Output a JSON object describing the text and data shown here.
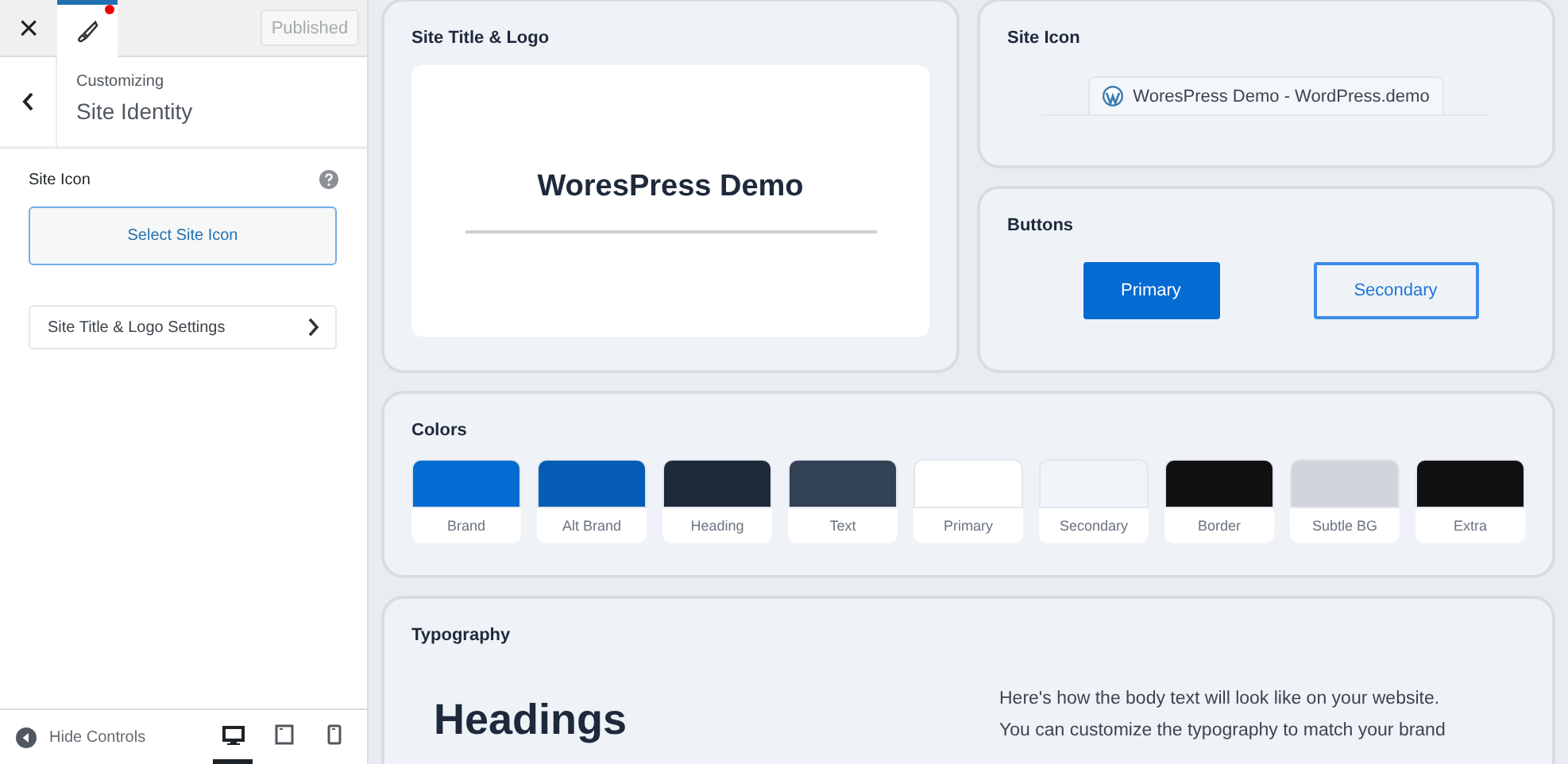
{
  "sidebar": {
    "close": "×",
    "publish_button": {
      "label": "Published",
      "disabled": true
    },
    "notification": true,
    "header": {
      "eyebrow": "Customizing",
      "title": "Site Identity"
    },
    "site_icon": {
      "label": "Site Icon",
      "button": "Select Site Icon"
    },
    "nav_item": {
      "label": "Site Title & Logo Settings"
    },
    "footer": {
      "label": "Hide Controls",
      "devices": [
        {
          "kind": "desktop",
          "selected": true
        },
        {
          "kind": "tablet",
          "selected": false
        },
        {
          "kind": "mobile",
          "selected": false
        }
      ]
    }
  },
  "preview": {
    "site_title_logo": {
      "title": "Site Title & Logo",
      "site_name": "WoresPress Demo"
    },
    "site_icon": {
      "title": "Site Icon",
      "tab_text": "WoresPress Demo - WordPress.demo"
    },
    "buttons": {
      "title": "Buttons",
      "items": [
        {
          "label": "Primary",
          "kind": "primary"
        },
        {
          "label": "Secondary",
          "kind": "secondary"
        }
      ]
    },
    "colors": {
      "title": "Colors",
      "swatches": [
        {
          "label": "Brand",
          "color": "#046bd2"
        },
        {
          "label": "Alt Brand",
          "color": "#045cb4"
        },
        {
          "label": "Heading",
          "color": "#1e293b"
        },
        {
          "label": "Text",
          "color": "#334155"
        },
        {
          "label": "Primary",
          "color": "#ffffff"
        },
        {
          "label": "Secondary",
          "color": "#f0f5fa"
        },
        {
          "label": "Border",
          "color": "#111111"
        },
        {
          "label": "Subtle BG",
          "color": "#d1d5db"
        },
        {
          "label": "Extra",
          "color": "#111111"
        }
      ]
    },
    "typography": {
      "title": "Typography",
      "heading": "Headings",
      "body": [
        "Here's how the body text will look like on your website.",
        "You can customize the typography to match your brand"
      ]
    }
  }
}
